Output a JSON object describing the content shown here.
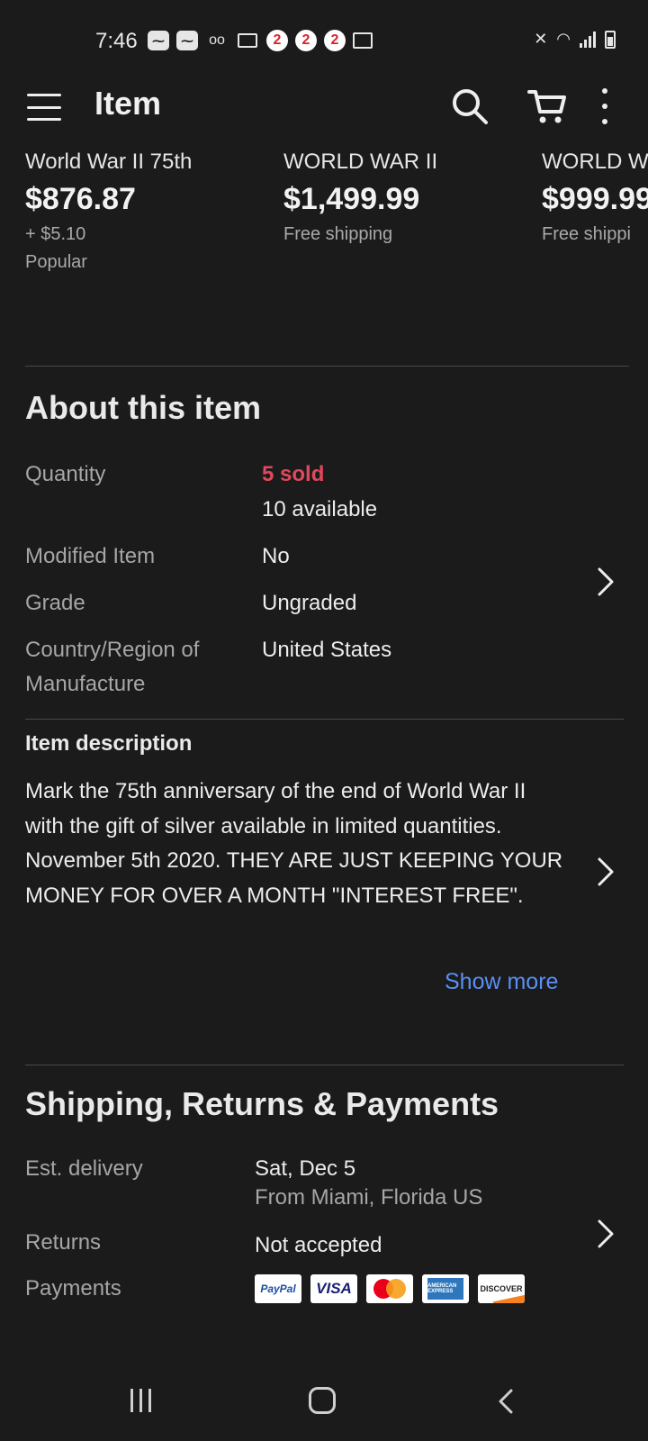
{
  "status_bar": {
    "time": "7:46",
    "notif_badge": "2"
  },
  "app_bar": {
    "title": "Item"
  },
  "carousel": [
    {
      "title": "World War II 75th",
      "price": "$876.87",
      "shipping": "+ $5.10",
      "tag": "Popular"
    },
    {
      "title": "WORLD WAR II",
      "price": "$1,499.99",
      "shipping": "Free shipping",
      "tag": ""
    },
    {
      "title": "WORLD W",
      "price": "$999.99",
      "shipping": "Free shippi",
      "tag": ""
    }
  ],
  "about": {
    "title": "About this item",
    "rows": [
      {
        "label": "Quantity",
        "value": "5 sold",
        "value2": "10 available"
      },
      {
        "label": "Modified Item",
        "value": "No"
      },
      {
        "label": "Grade",
        "value": "Ungraded"
      },
      {
        "label": "Country/Region of Manufacture",
        "label_line1": "Country/Region of",
        "label_line2": "Manufacture",
        "value": "United States"
      }
    ],
    "colors": {
      "sold": "#e0485c"
    }
  },
  "description": {
    "label": "Item description",
    "text": "Mark the 75th anniversary of the end of World War II with the gift of silver available in limited quantities. November 5th 2020. THEY ARE JUST KEEPING YOUR MONEY FOR OVER A MONTH \"INTEREST FREE\".",
    "show_more": "Show more"
  },
  "shipping": {
    "title": "Shipping, Returns & Payments",
    "est_delivery_label": "Est. delivery",
    "est_delivery_value": "Sat, Dec 5",
    "est_delivery_from": "From Miami, Florida US",
    "returns_label": "Returns",
    "returns_value": "Not accepted",
    "payments_label": "Payments",
    "payment_methods": [
      "PayPal",
      "VISA",
      "Mastercard",
      "American Express",
      "DISCOVER"
    ]
  },
  "pay_labels": {
    "paypal": "PayPal",
    "visa": "VISA",
    "amex": "AMERICAN EXPRESS",
    "discover": "DISCOVER"
  },
  "accent": "#5a8ff5"
}
